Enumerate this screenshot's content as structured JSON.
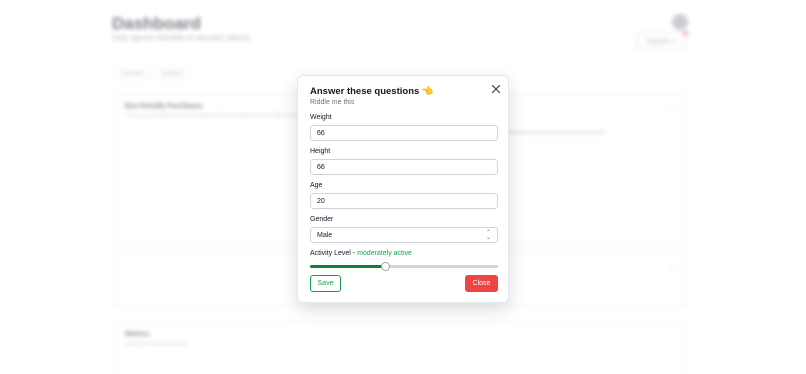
{
  "background": {
    "title": "Dashboard",
    "subtitle": "Daily, tigerate delicable on attended, tailored",
    "header_button": "Upgrade ✦",
    "tabs": [
      "Overview",
      "Analytics"
    ],
    "card1": {
      "title": "Eco-friendly Purchases",
      "subtitle": "Turn your purchases to some good of the ecosystem across different companies"
    },
    "card3": {
      "title": "Metrics",
      "subtitle": "View your activity metrics"
    }
  },
  "modal": {
    "title": "Answer these questions",
    "title_emoji": "👈",
    "subtitle": "Riddle me this",
    "fields": {
      "weight": {
        "label": "Weight",
        "value": "66"
      },
      "height": {
        "label": "Height",
        "value": "66"
      },
      "age": {
        "label": "Age",
        "value": "20"
      },
      "gender": {
        "label": "Gender",
        "value": "Male"
      }
    },
    "activity": {
      "label": "Activity Level - ",
      "level": "moderately active",
      "slider_value": 0.4
    },
    "save_label": "Save",
    "close_label": "Close"
  },
  "colors": {
    "accent_green": "#16a34a",
    "danger_red": "#ef4444"
  }
}
